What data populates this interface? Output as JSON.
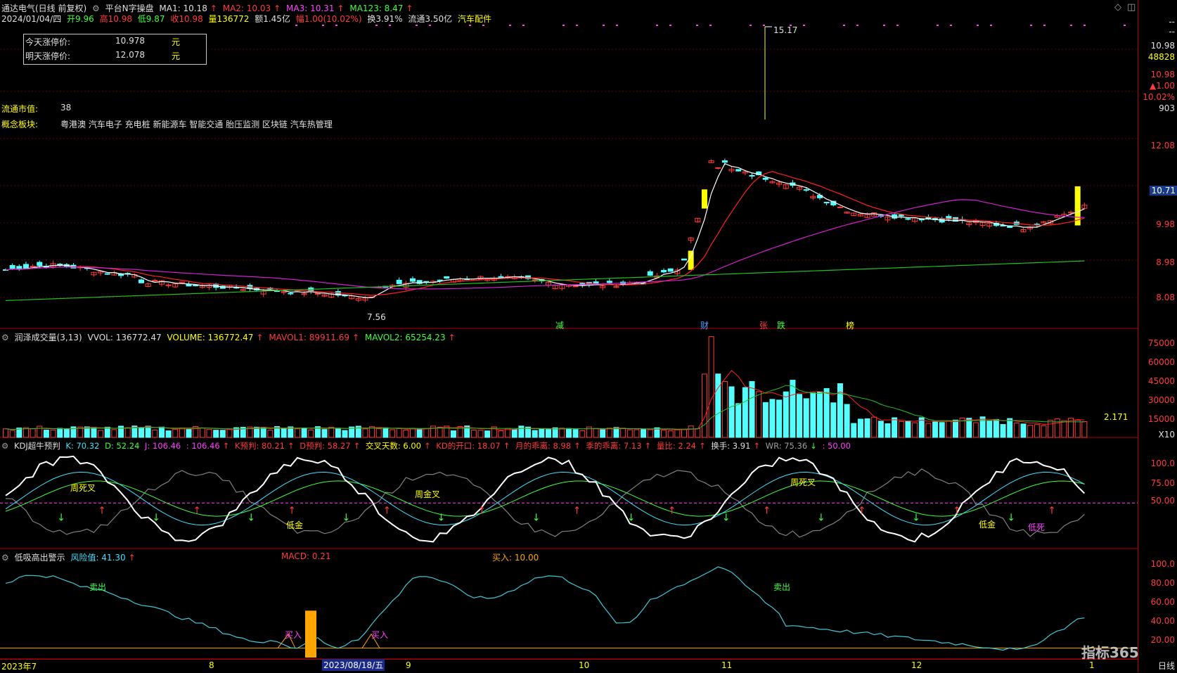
{
  "window": {
    "stock_title": "通达电气(日线 前复权)",
    "formula_name": "平台N字操盘",
    "ma1": "MA1: 10.18",
    "ma2": "MA2: 10.03",
    "ma3": "MA3: 10.31",
    "ma123": "MA123: 8.47"
  },
  "quote_line": {
    "date": "2024/01/04/四",
    "open": "开9.96",
    "high": "高10.98",
    "low": "低9.87",
    "close": "收10.98",
    "volume": "量136772",
    "amount": "额1.45亿",
    "change": "幅1.00(10.02%)",
    "turnover": "换3.91%",
    "float_cap": "流通3.50亿",
    "sector": "汽车配件"
  },
  "limit_box": {
    "today_label": "今天涨停价:",
    "today_value": "10.978",
    "tomorrow_label": "明天涨停价:",
    "tomorrow_value": "12.078",
    "unit": "元"
  },
  "info": {
    "float_label": "流通市值:",
    "float_value": "38",
    "concept_label": "概念板块:",
    "concept_value": "粤港澳 汽车电子 充电桩 新能源车 智能交通 胎压监测 区块链 汽车热管理"
  },
  "price_axis": {
    "top_dash": "--",
    "current_price": "10.98",
    "current_vol": "48828",
    "change_val": "10.98",
    "change_abs": "▲1.00",
    "change_pct": "10.02%",
    "extra": "903",
    "ticks": [
      "12.08",
      "10.71",
      "9.98",
      "8.98",
      "8.08"
    ],
    "high_label": "15.17",
    "low_label": "7.56"
  },
  "event_markers": [
    {
      "text": "减",
      "color": "#3cff3c"
    },
    {
      "text": "财",
      "color": "#40a0ff"
    },
    {
      "text": "张",
      "color": "#ff3b3b"
    },
    {
      "text": "跌",
      "color": "#3cff3c"
    },
    {
      "text": "榜",
      "color": "#ffff00"
    }
  ],
  "volume_panel": {
    "title": "润泽成交量(3,13)",
    "vvol": "VVOL: 136772.47",
    "volume": "VOLUME: 136772.47",
    "mavol1": "MAVOL1: 89911.69",
    "mavol2": "MAVOL2: 65254.23",
    "ticks": [
      "75000",
      "60000",
      "45000",
      "30000",
      "15000"
    ],
    "scale_note": "X10",
    "last_label": "2.171"
  },
  "kdj_panel": {
    "title": "KDJ超牛预判",
    "k": "K: 70.32",
    "d": "D: 52.24",
    "j": "J: 106.46",
    "j2": ": 106.46",
    "k_pred": "K预判: 80.21",
    "d_pred": "D预判: 58.27",
    "cross_days": "交叉天数: 6.00",
    "kd_open": "KD的开口: 18.07",
    "month_fit": "月的乖离: 8.98",
    "season_fit": "季的乖离: 7.13",
    "ratio": "量比: 2.24",
    "turnover": "换手: 3.91",
    "wr": "WR: 75.36",
    "extra": ": 50.00",
    "ticks": [
      "100.0",
      "75.00",
      "50.00"
    ],
    "annotations": [
      {
        "text": "周死叉",
        "color": "#ffff00"
      },
      {
        "text": "周金叉",
        "color": "#ffff00"
      },
      {
        "text": "低金",
        "color": "#ffff00"
      },
      {
        "text": "周死叉",
        "color": "#ffff00"
      },
      {
        "text": "低金",
        "color": "#ffff00"
      },
      {
        "text": "低死",
        "color": "#ff40ff"
      }
    ]
  },
  "risk_panel": {
    "title": "低吸高出警示",
    "risk": "风险值: 41.30",
    "macd": "MACD: 0.21",
    "buy": "买入: 10.00",
    "ticks": [
      "100.0",
      "80.00",
      "60.00",
      "40.00",
      "20.00"
    ],
    "annotations": [
      {
        "text": "卖出",
        "color": "#3cff3c"
      },
      {
        "text": "买入",
        "color": "#ff40ff"
      },
      {
        "text": "买入",
        "color": "#ff40ff"
      },
      {
        "text": "卖出",
        "color": "#3cff3c"
      }
    ]
  },
  "date_axis": {
    "labels": [
      "2023年7",
      "8",
      "2023/08/18/五",
      "9",
      "10",
      "11",
      "12",
      "1"
    ],
    "period": "日线"
  },
  "watermark": "指标365",
  "colors": {
    "up": "#ff3b3b",
    "down": "#54ffff",
    "limit_up": "#ffff00",
    "ma_white": "#ffffff",
    "ma_red": "#ff2020",
    "ma_magenta": "#d020d0",
    "ma_green": "#20c020",
    "border": "#b00000"
  }
}
